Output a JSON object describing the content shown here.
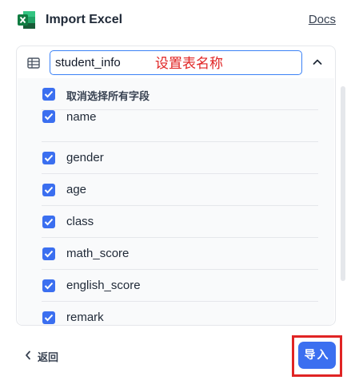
{
  "header": {
    "title": "Import Excel",
    "docs_label": "Docs",
    "icon": "excel-icon"
  },
  "table_name": {
    "icon": "table-icon",
    "value": "student_info",
    "annotation": "设置表名称"
  },
  "fields": {
    "toggle_all_label": "取消选择所有字段",
    "items": [
      {
        "label": "name",
        "checked": true
      },
      {
        "label": "gender",
        "checked": true
      },
      {
        "label": "age",
        "checked": true
      },
      {
        "label": "class",
        "checked": true
      },
      {
        "label": "math_score",
        "checked": true
      },
      {
        "label": "english_score",
        "checked": true
      },
      {
        "label": "remark",
        "checked": true
      }
    ]
  },
  "footer": {
    "back_label": "返回",
    "import_label": "导入"
  },
  "colors": {
    "accent": "#3b6ff0",
    "annotation": "#e02424",
    "excel_green": "#1d6f42"
  }
}
